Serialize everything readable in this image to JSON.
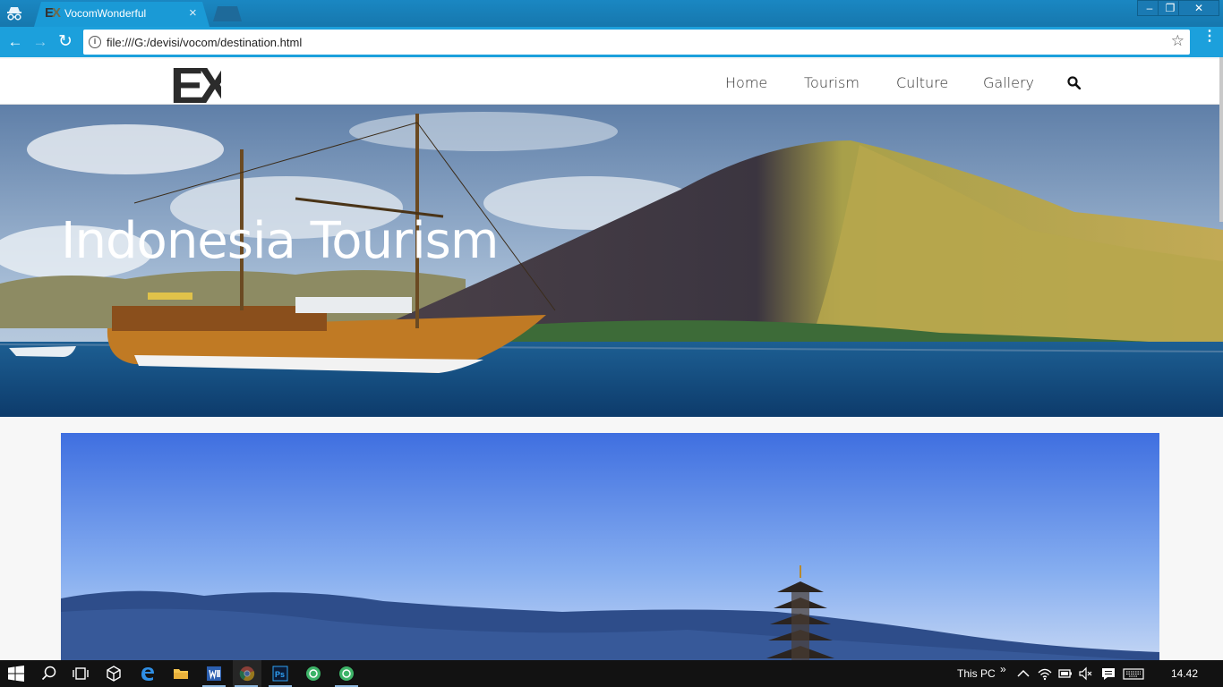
{
  "browser": {
    "tab_title": "VocomWonderful",
    "tab_close": "×",
    "url": "file:///G:/devisi/vocom/destination.html",
    "info_glyph": "i",
    "star": "☆",
    "back": "←",
    "forward": "→",
    "reload": "↻",
    "menu": "⋮",
    "window_min": "–",
    "window_max": "❐",
    "window_close": "✕"
  },
  "site": {
    "logo_text": "EX",
    "nav": [
      "Home",
      "Tourism",
      "Culture",
      "Gallery"
    ],
    "search_icon": "search-icon"
  },
  "hero": {
    "title": "Indonesia Tourism"
  },
  "taskbar": {
    "tray_label": "This PC",
    "tray_chevron": "»",
    "clock": "14.42"
  }
}
